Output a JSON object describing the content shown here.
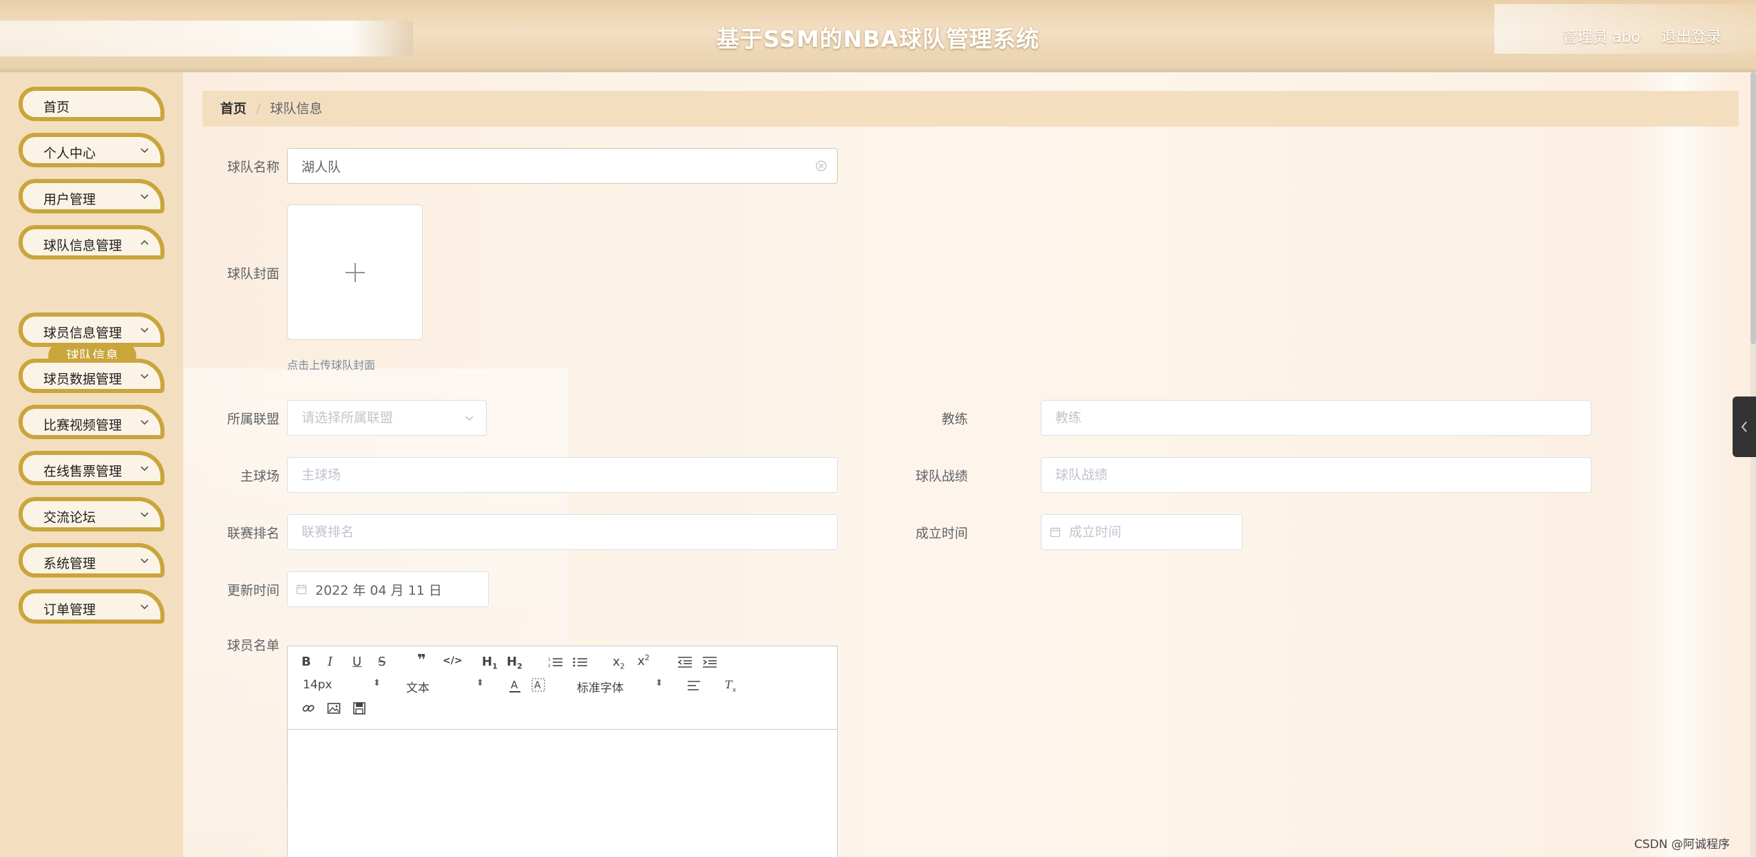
{
  "header": {
    "title": "基于SSM的NBA球队管理系统",
    "user": "管理员 abo",
    "logout": "退出登录"
  },
  "sidebar": {
    "items": [
      {
        "label": "首页",
        "has_arrow": false
      },
      {
        "label": "个人中心",
        "has_arrow": true
      },
      {
        "label": "用户管理",
        "has_arrow": true
      },
      {
        "label": "球队信息管理",
        "has_arrow": true
      },
      {
        "label": "球员信息管理",
        "has_arrow": true
      },
      {
        "label": "球员数据管理",
        "has_arrow": true
      },
      {
        "label": "比赛视频管理",
        "has_arrow": true
      },
      {
        "label": "在线售票管理",
        "has_arrow": true
      },
      {
        "label": "交流论坛",
        "has_arrow": true
      },
      {
        "label": "系统管理",
        "has_arrow": true
      },
      {
        "label": "订单管理",
        "has_arrow": true
      }
    ],
    "active_sub": "球队信息"
  },
  "breadcrumb": {
    "home": "首页",
    "separator": "/",
    "current": "球队信息"
  },
  "form": {
    "team_name": {
      "label": "球队名称",
      "value": "湖人队"
    },
    "cover": {
      "label": "球队封面",
      "tip": "点击上传球队封面"
    },
    "league": {
      "label": "所属联盟",
      "placeholder": "请选择所属联盟"
    },
    "coach": {
      "label": "教练",
      "placeholder": "教练"
    },
    "home_court": {
      "label": "主球场",
      "placeholder": "主球场"
    },
    "record": {
      "label": "球队战绩",
      "placeholder": "球队战绩"
    },
    "ranking": {
      "label": "联赛排名",
      "placeholder": "联赛排名"
    },
    "founded": {
      "label": "成立时间",
      "placeholder": "成立时间"
    },
    "updated": {
      "label": "更新时间",
      "value": "2022 年 04 月 11 日"
    },
    "roster": {
      "label": "球员名单"
    }
  },
  "editor": {
    "font_size": "14px",
    "header_format": "文本",
    "font_family": "标准字体"
  },
  "watermark": "CSDN @阿诚程序",
  "colors": {
    "accent": "#c9a53c",
    "sidebar_bg": "#f3dfc0",
    "header_bg": "#e9cfa9"
  }
}
